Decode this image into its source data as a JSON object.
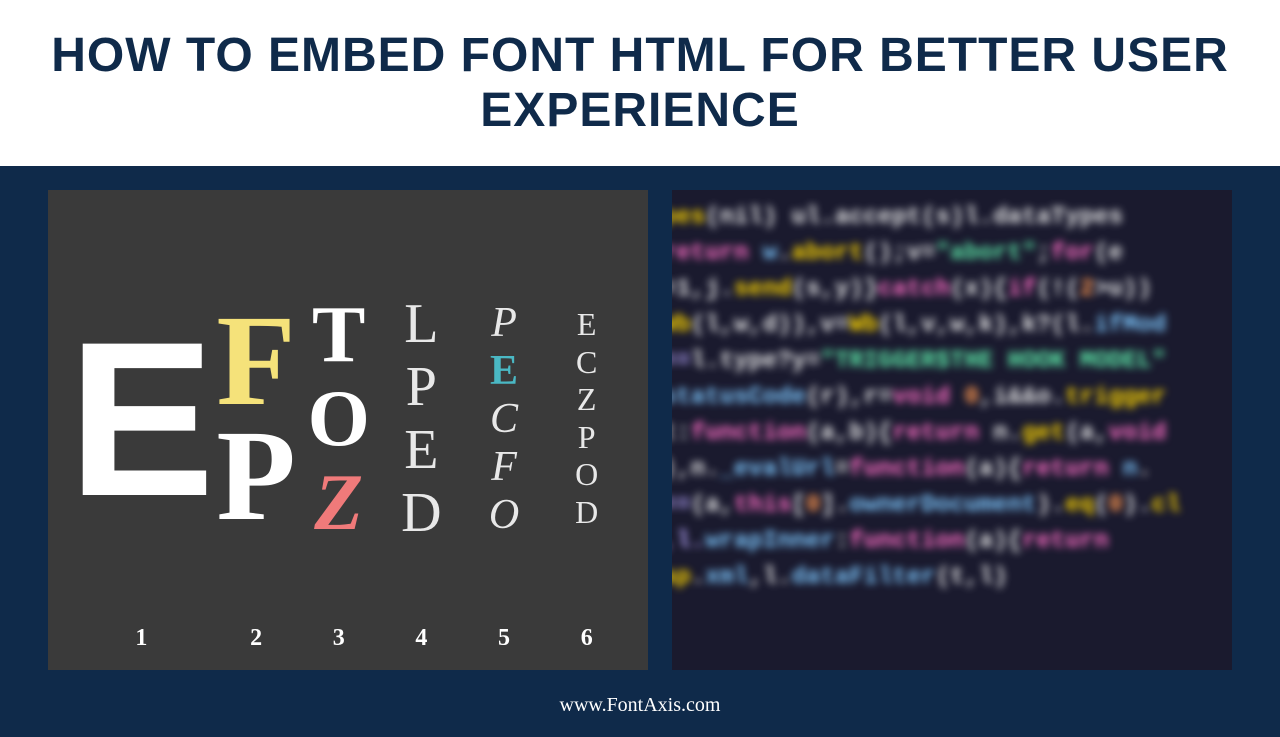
{
  "title": "HOW TO EMBED FONT HTML FOR BETTER USER EXPERIENCE",
  "footer": "www.FontAxis.com",
  "eyechart": {
    "columns": [
      {
        "num": "1",
        "letters": [
          "E"
        ]
      },
      {
        "num": "2",
        "letters": [
          "F",
          "P"
        ]
      },
      {
        "num": "3",
        "letters": [
          "T",
          "O",
          "Z"
        ]
      },
      {
        "num": "4",
        "letters": [
          "L",
          "P",
          "E",
          "D"
        ]
      },
      {
        "num": "5",
        "letters": [
          "P",
          "E",
          "C",
          "F",
          "O"
        ]
      },
      {
        "num": "6",
        "letters": [
          "E",
          "C",
          "Z",
          "P",
          "O",
          "D"
        ]
      }
    ]
  },
  "code": {
    "lines": [
      [
        [
          "func",
          "pes"
        ],
        [
          "punc",
          "(nil) ul.accept(s)l.dataTypes "
        ]
      ],
      [
        [
          "return",
          "return "
        ],
        [
          "var",
          "w"
        ],
        [
          "punc",
          "."
        ],
        [
          "func",
          "abort"
        ],
        [
          "punc",
          "();v="
        ],
        [
          "str",
          "\"abort\""
        ],
        [
          "punc",
          ";"
        ],
        [
          "return",
          "for"
        ],
        [
          "punc",
          "(e"
        ]
      ],
      [
        [
          "punc",
          "=1,j."
        ],
        [
          "func",
          "send"
        ],
        [
          "punc",
          "(s,y)}"
        ],
        [
          "return",
          "catch"
        ],
        [
          "punc",
          "(x){"
        ],
        [
          "return",
          "if"
        ],
        [
          "punc",
          "(!("
        ],
        [
          "num",
          "2"
        ],
        [
          "punc",
          ">u))"
        ]
      ],
      [
        [
          "func",
          "Wb"
        ],
        [
          "punc",
          "(l,w,d)),v="
        ],
        [
          "func",
          "Wb"
        ],
        [
          "punc",
          "(l,v,w,k),k?(l."
        ],
        [
          "var",
          "ifMod"
        ]
      ],
      [
        [
          "op",
          "=="
        ],
        [
          "punc",
          "l.type?y="
        ],
        [
          "str",
          "\"TRIGGER$THE HOOK MODEL\""
        ]
      ],
      [
        [
          "var",
          "statusCode"
        ],
        [
          "punc",
          "(r),r="
        ],
        [
          "return",
          "void "
        ],
        [
          "num",
          "0"
        ],
        [
          "punc",
          ",i&&o."
        ],
        [
          "func",
          "trigger"
        ]
      ],
      [
        [
          "punc",
          "t:"
        ],
        [
          "return",
          "function"
        ],
        [
          "punc",
          "(a,b){"
        ],
        [
          "return",
          "return "
        ],
        [
          "punc",
          "n."
        ],
        [
          "func",
          "get"
        ],
        [
          "punc",
          "(a,"
        ],
        [
          "return",
          "void"
        ]
      ],
      [
        [
          "punc",
          "),n."
        ],
        [
          "var",
          "_evalUrl"
        ],
        [
          "punc",
          "="
        ],
        [
          "return",
          "function"
        ],
        [
          "punc",
          "(a){"
        ],
        [
          "return",
          "return "
        ],
        [
          "var",
          "n"
        ],
        [
          "punc",
          "."
        ]
      ],
      [
        [
          "op",
          "=="
        ],
        [
          "punc",
          "(a,"
        ],
        [
          "return",
          "this"
        ],
        [
          "punc",
          "["
        ],
        [
          "num",
          "0"
        ],
        [
          "punc",
          "]."
        ],
        [
          "var",
          "ownerDocument"
        ],
        [
          "punc",
          ")."
        ],
        [
          "func",
          "eq"
        ],
        [
          "punc",
          "("
        ],
        [
          "num",
          "0"
        ],
        [
          "punc",
          ")."
        ],
        [
          "func",
          "cl"
        ]
      ],
      [
        [
          "op",
          ",l."
        ],
        [
          "var",
          "wrapInner"
        ],
        [
          "punc",
          ":"
        ],
        [
          "return",
          "function"
        ],
        [
          "punc",
          "(a){"
        ],
        [
          "return",
          "return"
        ]
      ],
      [
        [
          "func",
          "ap"
        ],
        [
          "punc",
          "."
        ],
        [
          "var",
          "xml"
        ],
        [
          "punc",
          ",l."
        ],
        [
          "var",
          "dataFilter"
        ],
        [
          "punc",
          "(t,l)"
        ]
      ]
    ]
  }
}
